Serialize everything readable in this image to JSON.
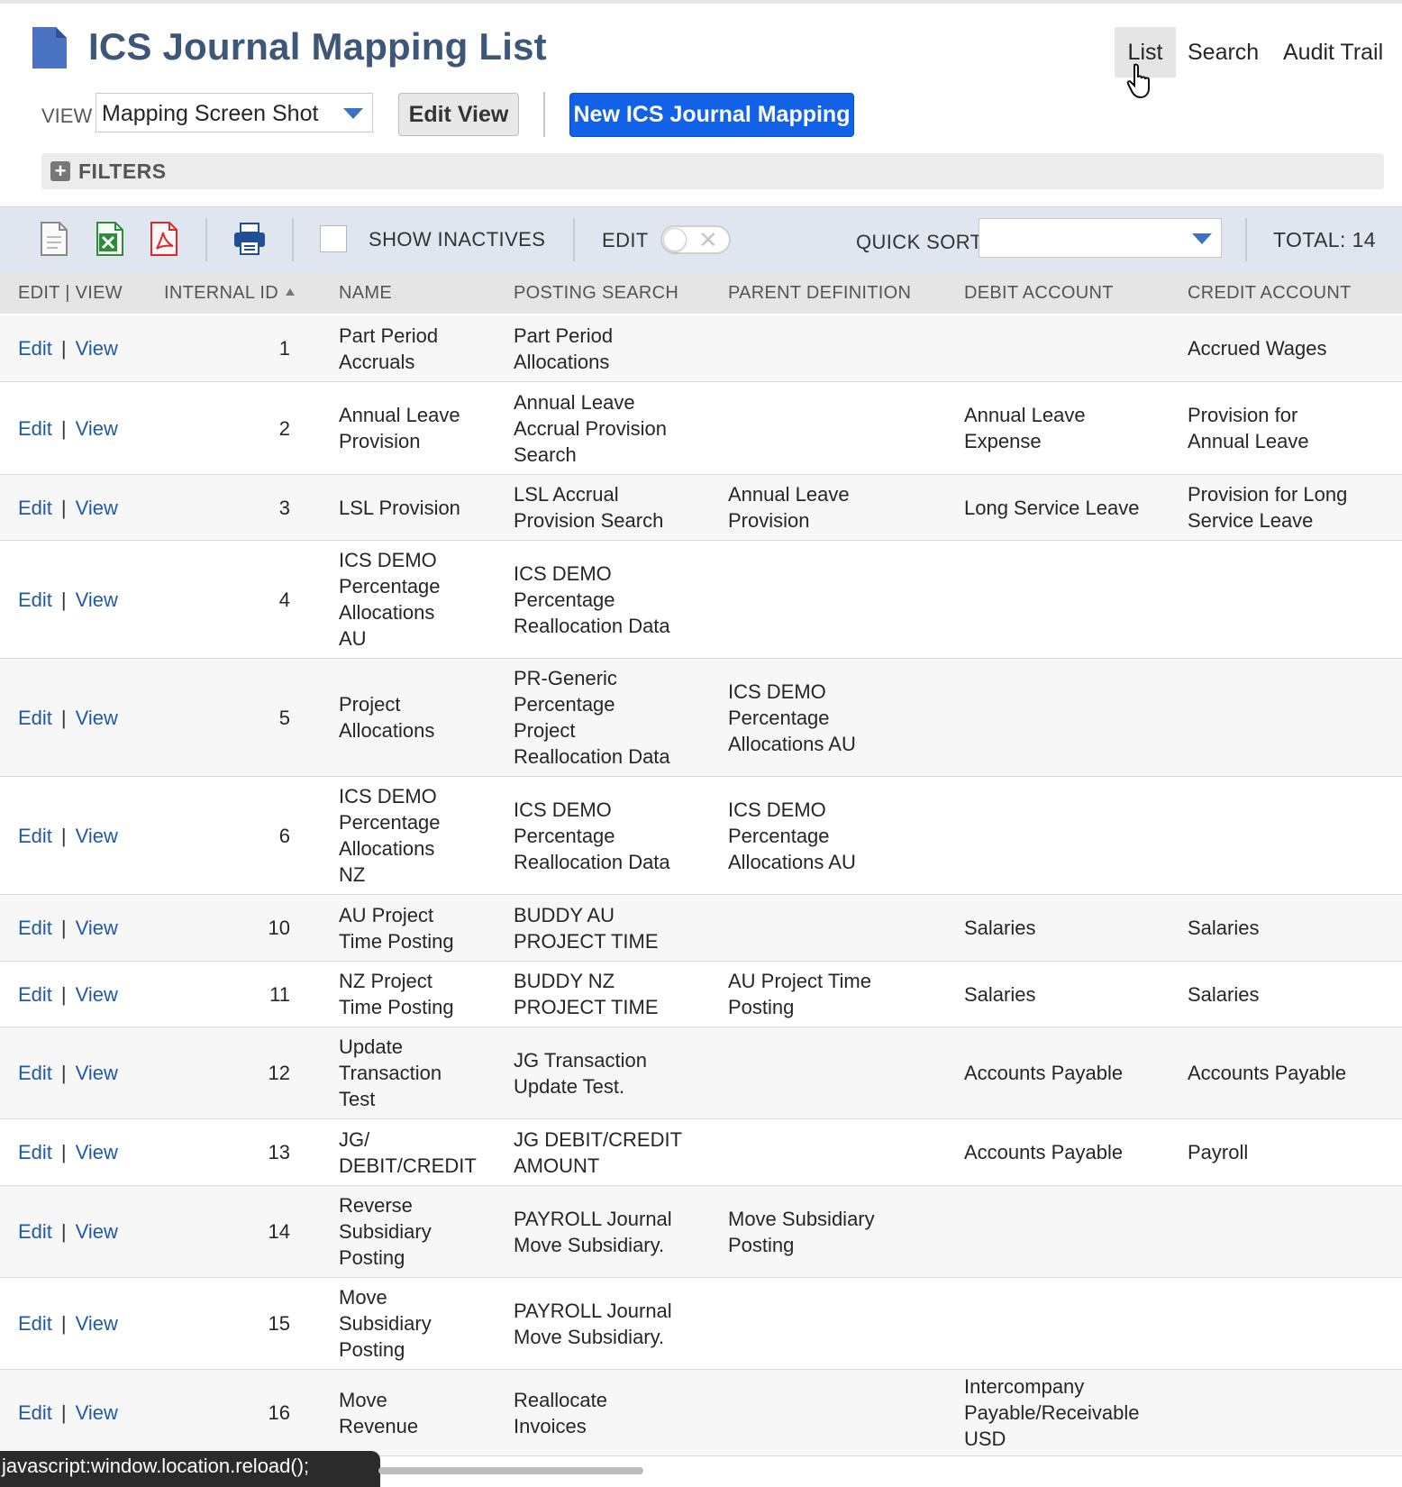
{
  "header": {
    "title": "ICS Journal Mapping List",
    "nav": {
      "list": "List",
      "search": "Search",
      "audit_trail": "Audit Trail"
    }
  },
  "view_bar": {
    "label": "VIEW",
    "selected_view": "Mapping Screen Shot",
    "edit_view_label": "Edit View",
    "new_button_label": "New ICS Journal Mapping"
  },
  "filters": {
    "label": "FILTERS"
  },
  "toolbar": {
    "show_inactives_label": "SHOW INACTIVES",
    "edit_label": "EDIT",
    "quick_sort_label": "QUICK SORT",
    "quick_sort_value": "",
    "total": "TOTAL: 14"
  },
  "table": {
    "headers": {
      "edit_view": "EDIT | VIEW",
      "internal_id": "INTERNAL ID",
      "name": "NAME",
      "posting_search": "POSTING SEARCH",
      "parent_definition": "PARENT DEFINITION",
      "debit_account": "DEBIT ACCOUNT",
      "credit_account": "CREDIT ACCOUNT"
    },
    "edit_link": "Edit",
    "view_link": "View",
    "separator": "|",
    "rows": [
      {
        "id": "1",
        "name": [
          "Part Period",
          "Accruals"
        ],
        "search": [
          "Part Period",
          "Allocations"
        ],
        "parent": [],
        "debit": [],
        "credit": [
          "Accrued Wages"
        ]
      },
      {
        "id": "2",
        "name": [
          "Annual Leave",
          "Provision"
        ],
        "search": [
          "Annual Leave",
          "Accrual Provision",
          "Search"
        ],
        "parent": [],
        "debit": [
          "Annual Leave",
          "Expense"
        ],
        "credit": [
          "Provision for",
          "Annual Leave"
        ]
      },
      {
        "id": "3",
        "name": [
          "LSL Provision"
        ],
        "search": [
          "LSL Accrual",
          "Provision Search"
        ],
        "parent": [
          "Annual Leave",
          "Provision"
        ],
        "debit": [
          "Long Service Leave"
        ],
        "credit": [
          "Provision for Long",
          "Service Leave"
        ]
      },
      {
        "id": "4",
        "name": [
          "ICS DEMO",
          "Percentage",
          "Allocations",
          "AU"
        ],
        "search": [
          "ICS DEMO",
          "Percentage",
          "Reallocation Data"
        ],
        "parent": [],
        "debit": [],
        "credit": []
      },
      {
        "id": "5",
        "name": [
          "Project",
          "Allocations"
        ],
        "search": [
          "PR-Generic",
          "Percentage",
          "Project",
          "Reallocation Data"
        ],
        "parent": [
          "ICS DEMO",
          "Percentage",
          "Allocations AU"
        ],
        "debit": [],
        "credit": []
      },
      {
        "id": "6",
        "name": [
          "ICS DEMO",
          "Percentage",
          "Allocations",
          "NZ"
        ],
        "search": [
          "ICS DEMO",
          "Percentage",
          "Reallocation Data"
        ],
        "parent": [
          "ICS DEMO",
          "Percentage",
          "Allocations AU"
        ],
        "debit": [],
        "credit": []
      },
      {
        "id": "10",
        "name": [
          "AU Project",
          "Time Posting"
        ],
        "search": [
          "BUDDY AU",
          "PROJECT TIME"
        ],
        "parent": [],
        "debit": [
          "Salaries"
        ],
        "credit": [
          "Salaries"
        ]
      },
      {
        "id": "11",
        "name": [
          "NZ Project",
          "Time Posting"
        ],
        "search": [
          "BUDDY NZ",
          "PROJECT TIME"
        ],
        "parent": [
          "AU Project Time",
          "Posting"
        ],
        "debit": [
          "Salaries"
        ],
        "credit": [
          "Salaries"
        ]
      },
      {
        "id": "12",
        "name": [
          "Update",
          "Transaction",
          "Test"
        ],
        "search": [
          "JG Transaction",
          "Update Test."
        ],
        "parent": [],
        "debit": [
          "Accounts Payable"
        ],
        "credit": [
          "Accounts Payable"
        ]
      },
      {
        "id": "13",
        "name": [
          "JG/",
          "DEBIT/CREDIT"
        ],
        "search": [
          "JG DEBIT/CREDIT",
          "AMOUNT"
        ],
        "parent": [],
        "debit": [
          "Accounts Payable"
        ],
        "credit": [
          "Payroll"
        ]
      },
      {
        "id": "14",
        "name": [
          "Reverse",
          "Subsidiary",
          "Posting"
        ],
        "search": [
          "PAYROLL Journal",
          "Move Subsidiary."
        ],
        "parent": [
          "Move Subsidiary",
          "Posting"
        ],
        "debit": [],
        "credit": []
      },
      {
        "id": "15",
        "name": [
          "Move",
          "Subsidiary",
          "Posting"
        ],
        "search": [
          "PAYROLL Journal",
          "Move Subsidiary."
        ],
        "parent": [],
        "debit": [],
        "credit": []
      },
      {
        "id": "16",
        "name": [
          "Move",
          "Revenue"
        ],
        "search": [
          "Reallocate",
          "Invoices"
        ],
        "parent": [],
        "debit": [
          "Intercompany",
          "Payable/Receivable",
          "USD"
        ],
        "credit": []
      }
    ]
  },
  "status_bar": {
    "text": "javascript:window.location.reload();"
  },
  "colors": {
    "title": "#3e5677",
    "primary_button": "#1162e6",
    "link": "#1e5aa8",
    "toolbar_bg": "#e0e6ef"
  }
}
